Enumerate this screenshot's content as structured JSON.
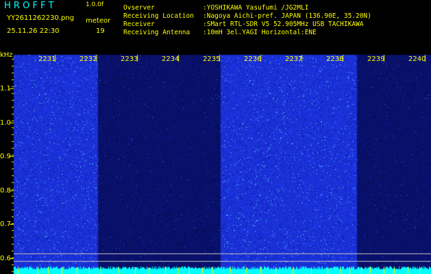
{
  "header": {
    "app_name": "H R O F F T",
    "version": "1.0.0f",
    "filename": "YY2611262230.png",
    "datetime": "25.11.26 22:30",
    "meteor_label": "meteor",
    "meteor_count": "19"
  },
  "info": {
    "labels": [
      "Ovserver",
      "Receiving Location",
      "Receiver",
      "Receiving Antenna"
    ],
    "values": [
      ":YOSHIKAWA Yasufumi /JG2MLI",
      ":Nagoya Aichi-pref. JAPAN (136.90E, 35.20N)",
      ":SMart RTL-SDR V5 52.905MHz USB TACHIKAWA",
      ":10mH 3el.YAGI Horizontal:ENE"
    ]
  },
  "spectrogram": {
    "y_unit": "kHz",
    "y_ticks": [
      "1.1",
      "1.0",
      "0.9",
      "0.8",
      "0.7",
      "0.6"
    ],
    "x_ticks": [
      "2231",
      "2232",
      "2233",
      "2234",
      "2235",
      "2236",
      "2237",
      "2238",
      "2239",
      "2240"
    ],
    "colors": {
      "bright": "#1a30d8",
      "dark": "#08106a",
      "noise": "#00ffff",
      "axis": "#ffff00"
    }
  }
}
